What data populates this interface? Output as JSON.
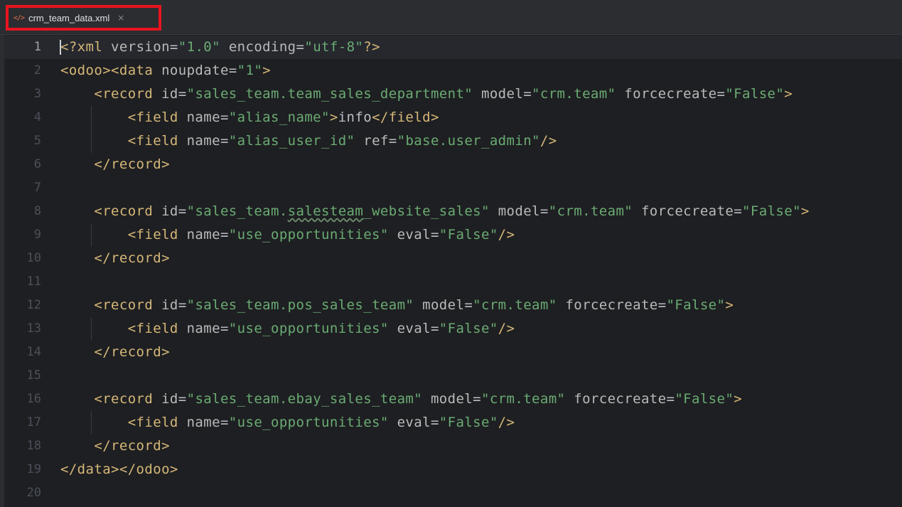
{
  "tab": {
    "icon": "</>",
    "filename": "crm_team_data.xml",
    "close": "×"
  },
  "editor": {
    "current_line": 1,
    "line_numbers": [
      "1",
      "2",
      "3",
      "4",
      "5",
      "6",
      "7",
      "8",
      "9",
      "10",
      "11",
      "12",
      "13",
      "14",
      "15",
      "16",
      "17",
      "18",
      "19",
      "20"
    ],
    "lines": [
      [
        {
          "t": "t",
          "v": "<?xml "
        },
        {
          "t": "a",
          "v": "version"
        },
        {
          "t": "p",
          "v": "="
        },
        {
          "t": "s",
          "v": "\"1.0\""
        },
        {
          "t": "p",
          "v": " "
        },
        {
          "t": "a",
          "v": "encoding"
        },
        {
          "t": "p",
          "v": "="
        },
        {
          "t": "s",
          "v": "\"utf-8\""
        },
        {
          "t": "t",
          "v": "?>"
        }
      ],
      [
        {
          "t": "t",
          "v": "<odoo><data "
        },
        {
          "t": "a",
          "v": "noupdate"
        },
        {
          "t": "p",
          "v": "="
        },
        {
          "t": "s",
          "v": "\"1\""
        },
        {
          "t": "t",
          "v": ">"
        }
      ],
      [
        {
          "t": "p",
          "v": "    "
        },
        {
          "t": "t",
          "v": "<record "
        },
        {
          "t": "a",
          "v": "id"
        },
        {
          "t": "p",
          "v": "="
        },
        {
          "t": "s",
          "v": "\"sales_team.team_sales_department\""
        },
        {
          "t": "p",
          "v": " "
        },
        {
          "t": "a",
          "v": "model"
        },
        {
          "t": "p",
          "v": "="
        },
        {
          "t": "s",
          "v": "\"crm.team\""
        },
        {
          "t": "p",
          "v": " "
        },
        {
          "t": "a",
          "v": "forcecreate"
        },
        {
          "t": "p",
          "v": "="
        },
        {
          "t": "s",
          "v": "\"False\""
        },
        {
          "t": "t",
          "v": ">"
        }
      ],
      [
        {
          "t": "p",
          "v": "        "
        },
        {
          "t": "t",
          "v": "<field "
        },
        {
          "t": "a",
          "v": "name"
        },
        {
          "t": "p",
          "v": "="
        },
        {
          "t": "s",
          "v": "\"alias_name\""
        },
        {
          "t": "t",
          "v": ">"
        },
        {
          "t": "p",
          "v": "info"
        },
        {
          "t": "t",
          "v": "</field>"
        }
      ],
      [
        {
          "t": "p",
          "v": "        "
        },
        {
          "t": "t",
          "v": "<field "
        },
        {
          "t": "a",
          "v": "name"
        },
        {
          "t": "p",
          "v": "="
        },
        {
          "t": "s",
          "v": "\"alias_user_id\""
        },
        {
          "t": "p",
          "v": " "
        },
        {
          "t": "a",
          "v": "ref"
        },
        {
          "t": "p",
          "v": "="
        },
        {
          "t": "s",
          "v": "\"base.user_admin\""
        },
        {
          "t": "t",
          "v": "/>"
        }
      ],
      [
        {
          "t": "p",
          "v": "    "
        },
        {
          "t": "t",
          "v": "</record>"
        }
      ],
      [],
      [
        {
          "t": "p",
          "v": "    "
        },
        {
          "t": "t",
          "v": "<record "
        },
        {
          "t": "a",
          "v": "id"
        },
        {
          "t": "p",
          "v": "="
        },
        {
          "t": "s",
          "v": "\"sales_team."
        },
        {
          "t": "sw",
          "v": "salesteam"
        },
        {
          "t": "s",
          "v": "_website_sales\""
        },
        {
          "t": "p",
          "v": " "
        },
        {
          "t": "a",
          "v": "model"
        },
        {
          "t": "p",
          "v": "="
        },
        {
          "t": "s",
          "v": "\"crm.team\""
        },
        {
          "t": "p",
          "v": " "
        },
        {
          "t": "a",
          "v": "forcecreate"
        },
        {
          "t": "p",
          "v": "="
        },
        {
          "t": "s",
          "v": "\"False\""
        },
        {
          "t": "t",
          "v": ">"
        }
      ],
      [
        {
          "t": "p",
          "v": "        "
        },
        {
          "t": "t",
          "v": "<field "
        },
        {
          "t": "a",
          "v": "name"
        },
        {
          "t": "p",
          "v": "="
        },
        {
          "t": "s",
          "v": "\"use_opportunities\""
        },
        {
          "t": "p",
          "v": " "
        },
        {
          "t": "a",
          "v": "eval"
        },
        {
          "t": "p",
          "v": "="
        },
        {
          "t": "s",
          "v": "\"False\""
        },
        {
          "t": "t",
          "v": "/>"
        }
      ],
      [
        {
          "t": "p",
          "v": "    "
        },
        {
          "t": "t",
          "v": "</record>"
        }
      ],
      [],
      [
        {
          "t": "p",
          "v": "    "
        },
        {
          "t": "t",
          "v": "<record "
        },
        {
          "t": "a",
          "v": "id"
        },
        {
          "t": "p",
          "v": "="
        },
        {
          "t": "s",
          "v": "\"sales_team.pos_sales_team\""
        },
        {
          "t": "p",
          "v": " "
        },
        {
          "t": "a",
          "v": "model"
        },
        {
          "t": "p",
          "v": "="
        },
        {
          "t": "s",
          "v": "\"crm.team\""
        },
        {
          "t": "p",
          "v": " "
        },
        {
          "t": "a",
          "v": "forcecreate"
        },
        {
          "t": "p",
          "v": "="
        },
        {
          "t": "s",
          "v": "\"False\""
        },
        {
          "t": "t",
          "v": ">"
        }
      ],
      [
        {
          "t": "p",
          "v": "        "
        },
        {
          "t": "t",
          "v": "<field "
        },
        {
          "t": "a",
          "v": "name"
        },
        {
          "t": "p",
          "v": "="
        },
        {
          "t": "s",
          "v": "\"use_opportunities\""
        },
        {
          "t": "p",
          "v": " "
        },
        {
          "t": "a",
          "v": "eval"
        },
        {
          "t": "p",
          "v": "="
        },
        {
          "t": "s",
          "v": "\"False\""
        },
        {
          "t": "t",
          "v": "/>"
        }
      ],
      [
        {
          "t": "p",
          "v": "    "
        },
        {
          "t": "t",
          "v": "</record>"
        }
      ],
      [],
      [
        {
          "t": "p",
          "v": "    "
        },
        {
          "t": "t",
          "v": "<record "
        },
        {
          "t": "a",
          "v": "id"
        },
        {
          "t": "p",
          "v": "="
        },
        {
          "t": "s",
          "v": "\"sales_team.ebay_sales_team\""
        },
        {
          "t": "p",
          "v": " "
        },
        {
          "t": "a",
          "v": "model"
        },
        {
          "t": "p",
          "v": "="
        },
        {
          "t": "s",
          "v": "\"crm.team\""
        },
        {
          "t": "p",
          "v": " "
        },
        {
          "t": "a",
          "v": "forcecreate"
        },
        {
          "t": "p",
          "v": "="
        },
        {
          "t": "s",
          "v": "\"False\""
        },
        {
          "t": "t",
          "v": ">"
        }
      ],
      [
        {
          "t": "p",
          "v": "        "
        },
        {
          "t": "t",
          "v": "<field "
        },
        {
          "t": "a",
          "v": "name"
        },
        {
          "t": "p",
          "v": "="
        },
        {
          "t": "s",
          "v": "\"use_opportunities\""
        },
        {
          "t": "p",
          "v": " "
        },
        {
          "t": "a",
          "v": "eval"
        },
        {
          "t": "p",
          "v": "="
        },
        {
          "t": "s",
          "v": "\"False\""
        },
        {
          "t": "t",
          "v": "/>"
        }
      ],
      [
        {
          "t": "p",
          "v": "    "
        },
        {
          "t": "t",
          "v": "</record>"
        }
      ],
      [
        {
          "t": "t",
          "v": "</data></odoo>"
        }
      ],
      []
    ]
  },
  "colors": {
    "tag": "#d5b778",
    "attribute": "#bababa",
    "string": "#6aab73",
    "plain": "#bcbec4",
    "highlight_box": "#e8141f"
  }
}
